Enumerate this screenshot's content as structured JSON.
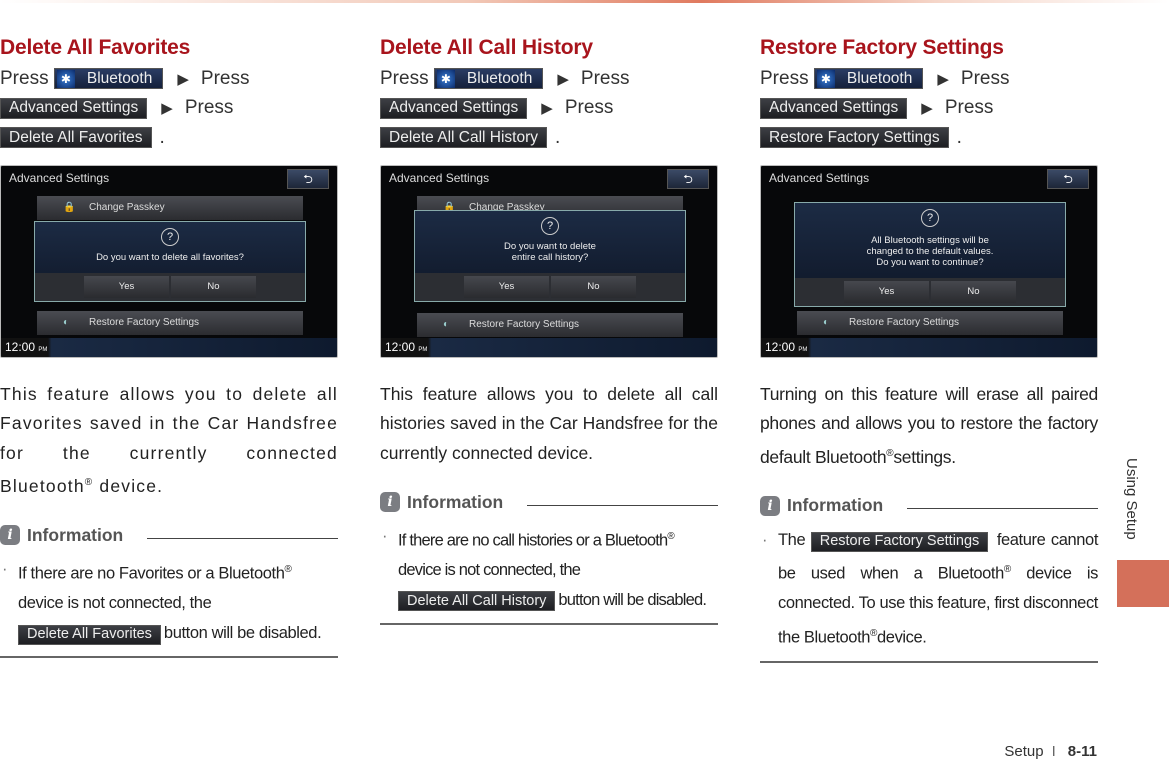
{
  "sidebar": {
    "section": "Using Setup",
    "tab_color": "#d4705a"
  },
  "footer": {
    "section": "Setup",
    "separator": "I",
    "page": "8-11"
  },
  "common": {
    "press": "Press",
    "period": ".",
    "bluetooth": "Bluetooth",
    "advanced": "Advanced Settings",
    "arrow": "▶",
    "info_title": "Information",
    "info_icon": "i",
    "reg": "®",
    "heading_color": "#a8141c"
  },
  "screen": {
    "title": "Advanced Settings",
    "back": "⮌",
    "change_passkey": "Change Passkey",
    "restore": "Restore Factory Settings",
    "yes": "Yes",
    "no": "No",
    "time": "12:00",
    "ampm": "PM",
    "question": "?"
  },
  "columns": [
    {
      "title": "Delete All Favorites",
      "button": "Delete All Favorites",
      "dialog": [
        "Do you want to delete all favorites?"
      ],
      "body_1": "This feature allows you to delete all Favorites saved in the Car Handsfree for the currently connected Bluetooth",
      "body_2": " device.",
      "info_1": "If there are no Favorites or a Bluetooth",
      "info_2": "device is not connected, the",
      "info_3": "button will be disabled."
    },
    {
      "title": "Delete All Call History",
      "button": "Delete All Call History",
      "dialog": [
        "Do you want to delete",
        "entire call history?"
      ],
      "body_1": "This feature allows you to delete all call histories saved in the Car Handsfree for the currently connected device.",
      "info_1": "If there are no call histories or a Bluetooth",
      "info_2": "device is not connected, the",
      "info_3": "button will be disabled."
    },
    {
      "title": "Restore Factory Settings",
      "button": "Restore Factory Settings",
      "dialog": [
        "All Bluetooth settings will be",
        "changed to the default values.",
        "Do you want to continue?"
      ],
      "body_1": "Turning on this feature will erase all paired phones and allows you to restore the factory default Bluetooth",
      "body_2": "settings.",
      "info_pre": "The",
      "info_1": "feature cannot be used when a Bluetooth",
      "info_2": "device is connected. To use this feature, first disconnect the Bluetooth",
      "info_3": "device."
    }
  ]
}
